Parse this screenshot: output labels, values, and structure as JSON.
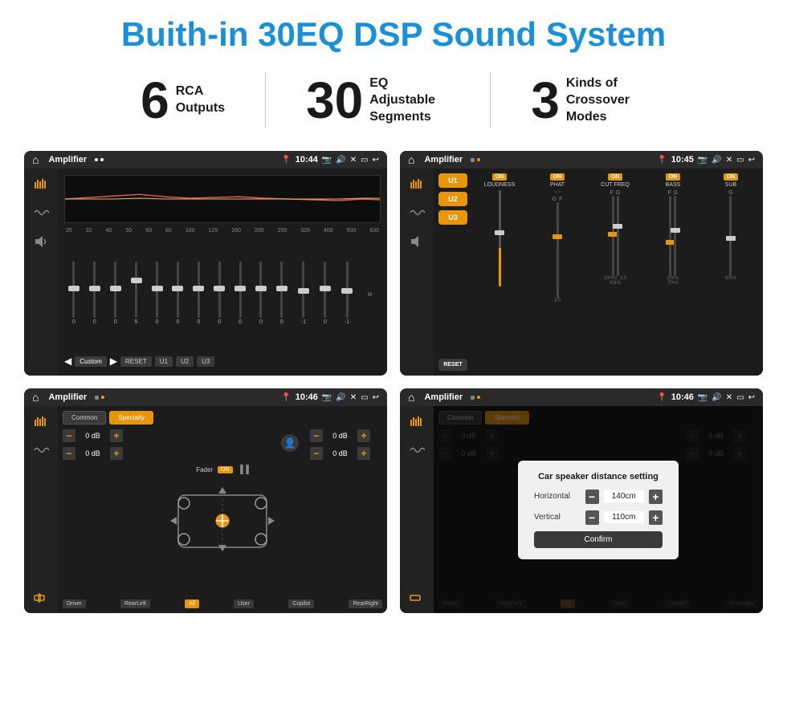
{
  "page": {
    "title": "Buith-in 30EQ DSP Sound System",
    "stats": [
      {
        "number": "6",
        "text": "RCA\nOutputs"
      },
      {
        "number": "30",
        "text": "EQ Adjustable\nSegments"
      },
      {
        "number": "3",
        "text": "Kinds of\nCrossover Modes"
      }
    ],
    "screenshots": [
      {
        "id": "eq-screen",
        "status_bar": {
          "title": "Amplifier",
          "time": "10:44"
        },
        "eq_frequencies": [
          "25",
          "32",
          "40",
          "50",
          "63",
          "80",
          "100",
          "125",
          "160",
          "200",
          "250",
          "320",
          "400",
          "500",
          "630"
        ],
        "eq_values": [
          "0",
          "0",
          "0",
          "5",
          "0",
          "0",
          "0",
          "0",
          "0",
          "0",
          "0",
          "-1",
          "0",
          "-1"
        ],
        "preset_label": "Custom",
        "buttons": [
          "RESET",
          "U1",
          "U2",
          "U3"
        ]
      },
      {
        "id": "amp-screen",
        "status_bar": {
          "title": "Amplifier",
          "time": "10:45"
        },
        "presets": [
          "U1",
          "U2",
          "U3"
        ],
        "channels": [
          {
            "on": true,
            "name": "LOUDNESS"
          },
          {
            "on": true,
            "name": "PHAT"
          },
          {
            "on": true,
            "name": "CUT FREQ"
          },
          {
            "on": true,
            "name": "BASS"
          },
          {
            "on": true,
            "name": "SUB"
          }
        ],
        "reset_label": "RESET"
      },
      {
        "id": "crossover-screen",
        "status_bar": {
          "title": "Amplifier",
          "time": "10:46"
        },
        "tabs": [
          "Common",
          "Specialty"
        ],
        "fader_label": "Fader",
        "fader_on": "ON",
        "volume_rows": [
          {
            "label": "",
            "value": "0 dB"
          },
          {
            "label": "",
            "value": "0 dB"
          },
          {
            "label": "",
            "value": "0 dB"
          },
          {
            "label": "",
            "value": "0 dB"
          }
        ],
        "bottom_labels": [
          "Driver",
          "RearLeft",
          "All",
          "User",
          "Copilot",
          "RearRight"
        ]
      },
      {
        "id": "distance-screen",
        "status_bar": {
          "title": "Amplifier",
          "time": "10:46"
        },
        "tabs": [
          "Common",
          "Specialty"
        ],
        "modal": {
          "title": "Car speaker distance setting",
          "rows": [
            {
              "label": "Horizontal",
              "value": "140cm"
            },
            {
              "label": "Vertical",
              "value": "110cm"
            }
          ],
          "confirm_label": "Confirm"
        },
        "bottom_labels": [
          "Driver",
          "RearLeft",
          "All",
          "User",
          "Copilot",
          "RearRight"
        ]
      }
    ]
  }
}
